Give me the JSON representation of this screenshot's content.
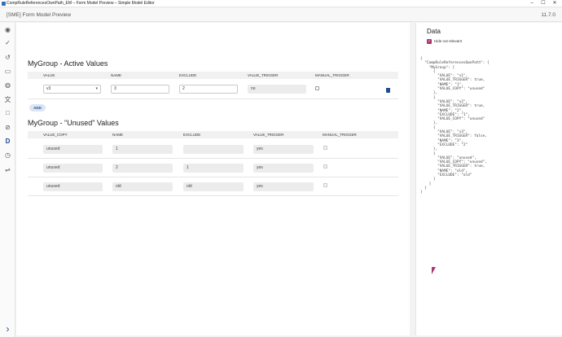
{
  "window": {
    "title": "CompRuleReferencesOwnPath_EM – Form Model Preview – Simple Model Editor",
    "minimize": "–",
    "maximize": "☐",
    "close": "✕"
  },
  "header": {
    "title": "[SME] Form Model Preview",
    "version": "11.7.0"
  },
  "sidebar": {
    "items": [
      {
        "icon": "eye-icon",
        "glyph": "◉"
      },
      {
        "icon": "check-icon",
        "glyph": "✓"
      },
      {
        "icon": "history-icon",
        "glyph": "↺"
      },
      {
        "icon": "truck-icon",
        "glyph": "▭"
      },
      {
        "icon": "palette-icon",
        "glyph": "◍"
      },
      {
        "icon": "translate-icon",
        "glyph": "文"
      },
      {
        "icon": "square-icon",
        "glyph": "□"
      },
      {
        "icon": "hidden-icon",
        "glyph": "⊘"
      },
      {
        "icon": "d-icon",
        "glyph": "D"
      },
      {
        "icon": "clock-icon",
        "glyph": "◷"
      },
      {
        "icon": "settings-icon",
        "glyph": "⇌"
      },
      {
        "icon": "expand-icon",
        "glyph": "›"
      }
    ]
  },
  "active": {
    "title": "MyGroup - Active Values",
    "columns": [
      "VALUE",
      "NAME",
      "EXCLUDE",
      "VALUE_TRIGGER",
      "MANUAL_TRIGGER"
    ],
    "row": {
      "value": "v3",
      "name": "3",
      "exclude": "2",
      "value_trigger": "no"
    },
    "add_label": "ADD"
  },
  "unused": {
    "title": "MyGroup - \"Unused\" Values",
    "columns": [
      "VALUE_COPY",
      "NAME",
      "EXCLUDE",
      "VALUE_TRIGGER",
      "MANUAL_TRIGGER"
    ],
    "rows": [
      {
        "value_copy": "unused",
        "name": "1",
        "exclude": "",
        "value_trigger": "yes"
      },
      {
        "value_copy": "unused",
        "name": "2",
        "exclude": "1",
        "value_trigger": "yes"
      },
      {
        "value_copy": "unused",
        "name": "old",
        "exclude": "old",
        "value_trigger": "yes"
      }
    ]
  },
  "data_panel": {
    "title": "Data",
    "hide_label": "Hide not relevant",
    "json_text": "{\n  \"CompRuleReferencesOwnPath\": {\n    \"MyGroup\": [\n      {\n        \"VALUE\": \"v1\",\n        \"VALUE_TRIGGER\": true,\n        \"NAME\": \"1\",\n        \"VALUE_COPY\": \"unused\"\n      },\n      {\n        \"VALUE\": \"v2\",\n        \"VALUE_TRIGGER\": true,\n        \"NAME\": \"2\",\n        \"EXCLUDE\": \"1\",\n        \"VALUE_COPY\": \"unused\"\n      },\n      {\n        \"VALUE\": \"v3\",\n        \"VALUE_TRIGGER\": false,\n        \"NAME\": \"3\",\n        \"EXCLUDE\": \"2\"\n      },\n      {\n        \"VALUE\": \"unused\",\n        \"VALUE_COPY\": \"unused\",\n        \"VALUE_TRIGGER\": true,\n        \"NAME\": \"old\",\n        \"EXCLUDE\": \"old\"\n      }\n    ]\n  }\n}"
  },
  "colors": {
    "accent": "#1e4e8c",
    "checkbox": "#a8356d"
  }
}
